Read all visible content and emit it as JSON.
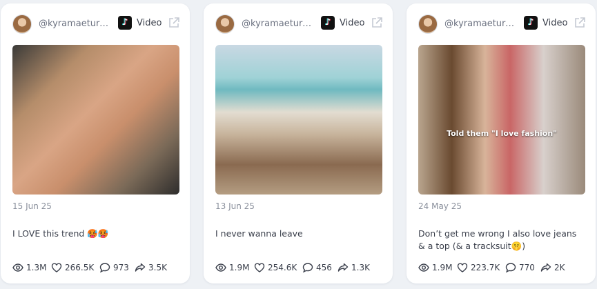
{
  "cards": [
    {
      "username": "@kyramaeturn...",
      "platform_label": "Video",
      "date": "15 Jun 25",
      "caption": "I LOVE this trend 🥵🥵",
      "overlay_text": "",
      "views": "1.3M",
      "likes": "266.5K",
      "comments": "973",
      "shares": "3.5K"
    },
    {
      "username": "@kyramaeturn...",
      "platform_label": "Video",
      "date": "13 Jun 25",
      "caption": "I never wanna leave",
      "overlay_text": "",
      "views": "1.9M",
      "likes": "254.6K",
      "comments": "456",
      "shares": "1.3K"
    },
    {
      "username": "@kyramaeturn...",
      "platform_label": "Video",
      "date": "24 May 25",
      "caption": "Don’t get me wrong I also love jeans & a top (& a tracksuit🤫)",
      "overlay_text": "Told them \"I love fashion\"",
      "views": "1.9M",
      "likes": "223.7K",
      "comments": "770",
      "shares": "2K"
    }
  ],
  "icons": {
    "platform": "tiktok-icon",
    "external": "external-link-icon",
    "views": "eye-icon",
    "likes": "heart-icon",
    "comments": "comment-icon",
    "shares": "share-icon"
  },
  "colors": {
    "background": "#eef1f5",
    "card": "#ffffff",
    "muted_text": "#8a909c"
  }
}
